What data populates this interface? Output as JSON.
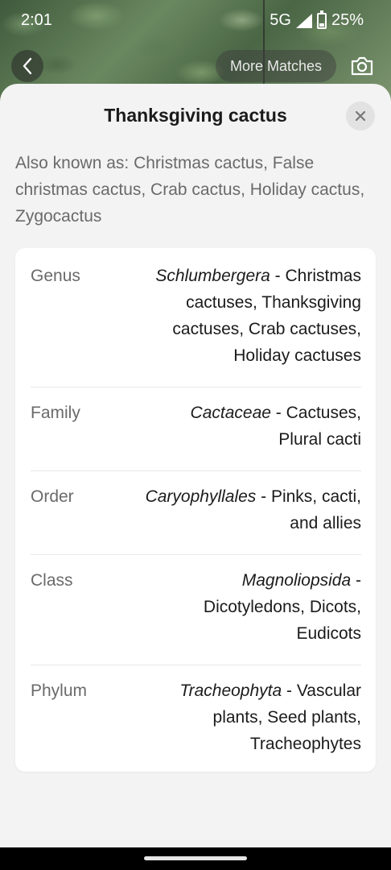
{
  "status_bar": {
    "time": "2:01",
    "network": "5G",
    "battery": "25%"
  },
  "top_bar": {
    "more_matches_label": "More Matches"
  },
  "sheet": {
    "title": "Thanksgiving cactus",
    "also_known_as": "Also known as: Christmas cactus, False christmas cactus, Crab cactus, Holiday cactus, Zygocactus",
    "taxonomy": [
      {
        "label": "Genus",
        "scientific": "Schlumbergera",
        "common": " - Christmas cactuses, Thanksgiving cactuses, Crab cactuses, Holiday cactuses"
      },
      {
        "label": "Family",
        "scientific": "Cactaceae",
        "common": " - Cactuses, Plural cacti"
      },
      {
        "label": "Order",
        "scientific": "Caryophyllales",
        "common": " - Pinks, cacti, and allies"
      },
      {
        "label": "Class",
        "scientific": "Magnoliopsida",
        "common": " - Dicotyledons, Dicots, Eudicots"
      },
      {
        "label": "Phylum",
        "scientific": "Tracheophyta",
        "common": " - Vascular plants, Seed plants, Tracheophytes"
      }
    ]
  },
  "icons": {
    "back": "back-arrow-icon",
    "camera": "camera-icon",
    "close": "close-icon",
    "signal": "signal-icon",
    "battery": "battery-icon"
  }
}
